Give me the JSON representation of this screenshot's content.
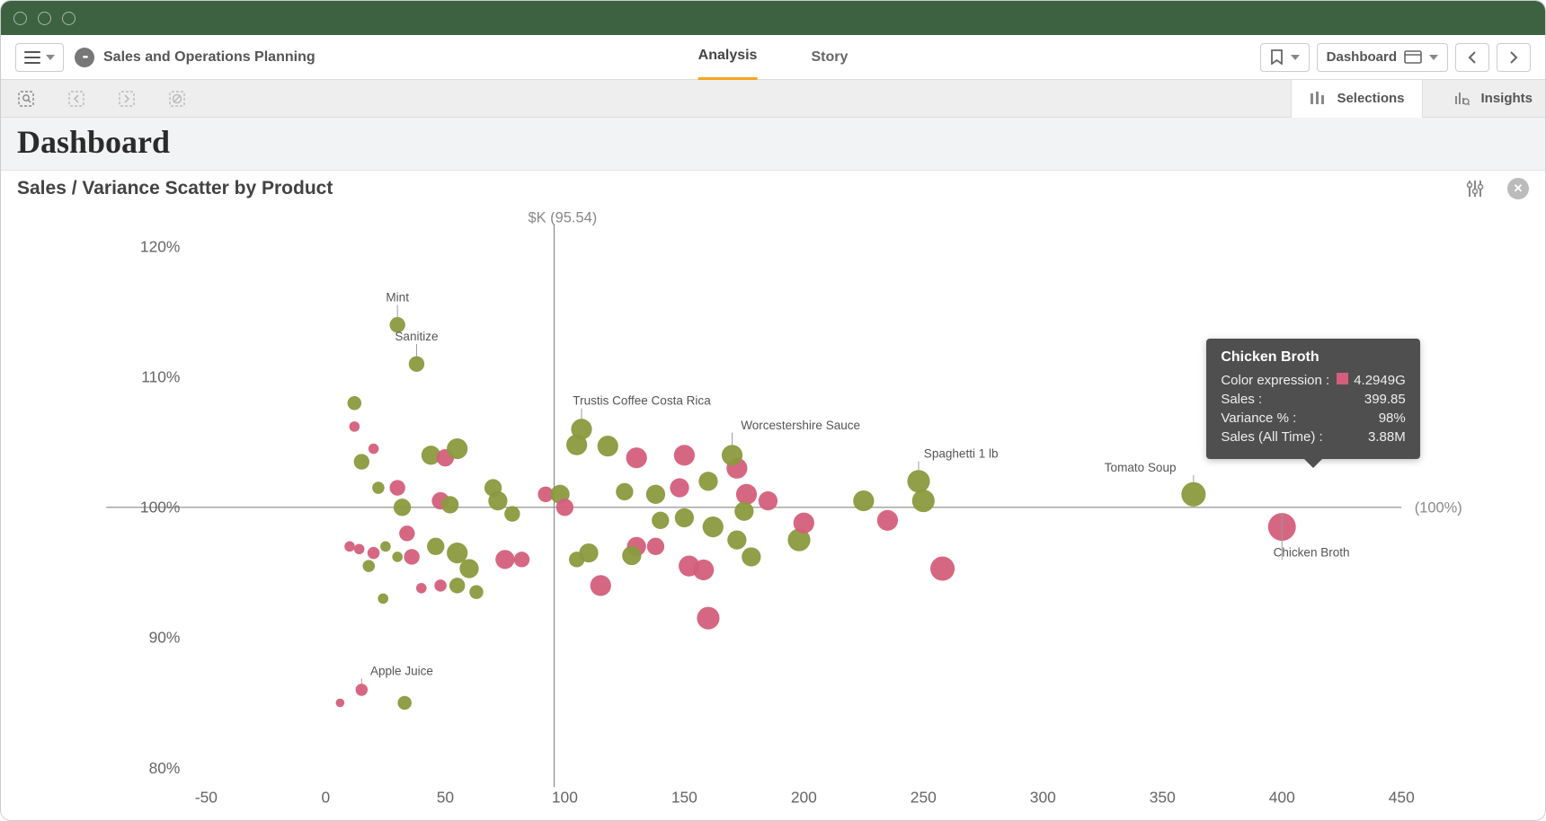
{
  "header": {
    "app_title": "Sales and Operations Planning",
    "tabs": {
      "analysis": "Analysis",
      "story": "Story",
      "active": "analysis"
    },
    "sheet_label": "Dashboard"
  },
  "selection_bar": {
    "selections_label": "Selections",
    "insights_label": "Insights"
  },
  "page": {
    "title": "Dashboard",
    "chart_title": "Sales / Variance Scatter by Product"
  },
  "tooltip": {
    "title": "Chicken Broth",
    "rows": [
      {
        "k": "Color expression :",
        "v": "4.2949G",
        "swatch": true
      },
      {
        "k": "Sales :",
        "v": "399.85"
      },
      {
        "k": "Variance % :",
        "v": "98%"
      },
      {
        "k": "Sales (All Time) :",
        "v": "3.88M"
      }
    ]
  },
  "chart_data": {
    "type": "scatter",
    "title": "Sales / Variance Scatter by Product",
    "xlabel": "",
    "ylabel": "",
    "xlim": [
      -50,
      450
    ],
    "ylim": [
      80,
      120
    ],
    "x_ticks": [
      -50,
      0,
      50,
      100,
      150,
      200,
      250,
      300,
      350,
      400,
      450
    ],
    "y_ticks": [
      80,
      90,
      100,
      110,
      120
    ],
    "x_ref_line": {
      "value": 95.54,
      "label": "$K (95.54)"
    },
    "y_ref_line": {
      "value": 100,
      "label": "(100%)"
    },
    "colors": {
      "green": "#8a9a3e",
      "pink": "#d45f7c"
    },
    "labeled_points": [
      {
        "name": "Mint",
        "x": 30,
        "y": 114,
        "color": "green",
        "size": 9
      },
      {
        "name": "Sanitize",
        "x": 38,
        "y": 111,
        "color": "green",
        "size": 9
      },
      {
        "name": "Trustis Coffee Costa Rica",
        "x": 107,
        "y": 106,
        "color": "green",
        "size": 12
      },
      {
        "name": "Worcestershire Sauce",
        "x": 170,
        "y": 104,
        "color": "green",
        "size": 12
      },
      {
        "name": "Spaghetti 1 lb",
        "x": 248,
        "y": 102,
        "color": "green",
        "size": 13
      },
      {
        "name": "Tomato Soup",
        "x": 363,
        "y": 101,
        "color": "green",
        "size": 14
      },
      {
        "name": "Chicken Broth",
        "x": 400,
        "y": 98.5,
        "color": "pink",
        "size": 16
      },
      {
        "name": "Apple Juice",
        "x": 15,
        "y": 86,
        "color": "pink",
        "size": 7
      }
    ],
    "points": [
      {
        "x": 12,
        "y": 108,
        "color": "green",
        "size": 8
      },
      {
        "x": 12,
        "y": 106.2,
        "color": "pink",
        "size": 6
      },
      {
        "x": 15,
        "y": 103.5,
        "color": "green",
        "size": 9
      },
      {
        "x": 20,
        "y": 104.5,
        "color": "pink",
        "size": 6
      },
      {
        "x": 22,
        "y": 101.5,
        "color": "green",
        "size": 7
      },
      {
        "x": 10,
        "y": 97,
        "color": "pink",
        "size": 6
      },
      {
        "x": 14,
        "y": 96.8,
        "color": "pink",
        "size": 6
      },
      {
        "x": 20,
        "y": 96.5,
        "color": "pink",
        "size": 7
      },
      {
        "x": 25,
        "y": 97,
        "color": "green",
        "size": 6
      },
      {
        "x": 18,
        "y": 95.5,
        "color": "green",
        "size": 7
      },
      {
        "x": 24,
        "y": 93,
        "color": "green",
        "size": 6
      },
      {
        "x": 6,
        "y": 85,
        "color": "pink",
        "size": 5
      },
      {
        "x": 33,
        "y": 85,
        "color": "green",
        "size": 8
      },
      {
        "x": 30,
        "y": 101.5,
        "color": "pink",
        "size": 9
      },
      {
        "x": 32,
        "y": 100,
        "color": "green",
        "size": 10
      },
      {
        "x": 34,
        "y": 98,
        "color": "pink",
        "size": 9
      },
      {
        "x": 36,
        "y": 96.2,
        "color": "pink",
        "size": 9
      },
      {
        "x": 30,
        "y": 96.2,
        "color": "green",
        "size": 6
      },
      {
        "x": 40,
        "y": 93.8,
        "color": "pink",
        "size": 6
      },
      {
        "x": 44,
        "y": 104,
        "color": "green",
        "size": 11
      },
      {
        "x": 50,
        "y": 103.8,
        "color": "pink",
        "size": 10
      },
      {
        "x": 55,
        "y": 104.5,
        "color": "green",
        "size": 12
      },
      {
        "x": 48,
        "y": 100.5,
        "color": "pink",
        "size": 10
      },
      {
        "x": 52,
        "y": 100.2,
        "color": "green",
        "size": 10
      },
      {
        "x": 46,
        "y": 97,
        "color": "green",
        "size": 10
      },
      {
        "x": 55,
        "y": 96.5,
        "color": "green",
        "size": 12
      },
      {
        "x": 60,
        "y": 95.3,
        "color": "green",
        "size": 11
      },
      {
        "x": 55,
        "y": 94,
        "color": "green",
        "size": 9
      },
      {
        "x": 48,
        "y": 94,
        "color": "pink",
        "size": 7
      },
      {
        "x": 63,
        "y": 93.5,
        "color": "green",
        "size": 8
      },
      {
        "x": 70,
        "y": 101.5,
        "color": "green",
        "size": 10
      },
      {
        "x": 72,
        "y": 100.5,
        "color": "green",
        "size": 11
      },
      {
        "x": 78,
        "y": 99.5,
        "color": "green",
        "size": 9
      },
      {
        "x": 75,
        "y": 96,
        "color": "pink",
        "size": 11
      },
      {
        "x": 82,
        "y": 96,
        "color": "pink",
        "size": 9
      },
      {
        "x": 92,
        "y": 101,
        "color": "pink",
        "size": 9
      },
      {
        "x": 98,
        "y": 101,
        "color": "green",
        "size": 11
      },
      {
        "x": 100,
        "y": 100,
        "color": "pink",
        "size": 10
      },
      {
        "x": 105,
        "y": 104.8,
        "color": "green",
        "size": 12
      },
      {
        "x": 118,
        "y": 104.7,
        "color": "green",
        "size": 12
      },
      {
        "x": 110,
        "y": 96.5,
        "color": "green",
        "size": 11
      },
      {
        "x": 115,
        "y": 94,
        "color": "pink",
        "size": 12
      },
      {
        "x": 105,
        "y": 96,
        "color": "green",
        "size": 9
      },
      {
        "x": 125,
        "y": 101.2,
        "color": "green",
        "size": 10
      },
      {
        "x": 130,
        "y": 103.8,
        "color": "pink",
        "size": 12
      },
      {
        "x": 130,
        "y": 97,
        "color": "pink",
        "size": 11
      },
      {
        "x": 128,
        "y": 96.3,
        "color": "green",
        "size": 11
      },
      {
        "x": 138,
        "y": 101,
        "color": "green",
        "size": 11
      },
      {
        "x": 138,
        "y": 97,
        "color": "pink",
        "size": 10
      },
      {
        "x": 140,
        "y": 99,
        "color": "green",
        "size": 10
      },
      {
        "x": 150,
        "y": 104,
        "color": "pink",
        "size": 12
      },
      {
        "x": 150,
        "y": 99.2,
        "color": "green",
        "size": 11
      },
      {
        "x": 148,
        "y": 101.5,
        "color": "pink",
        "size": 11
      },
      {
        "x": 152,
        "y": 95.5,
        "color": "pink",
        "size": 12
      },
      {
        "x": 158,
        "y": 95.2,
        "color": "pink",
        "size": 12
      },
      {
        "x": 160,
        "y": 102,
        "color": "green",
        "size": 11
      },
      {
        "x": 162,
        "y": 98.5,
        "color": "green",
        "size": 12
      },
      {
        "x": 160,
        "y": 91.5,
        "color": "pink",
        "size": 13
      },
      {
        "x": 172,
        "y": 103,
        "color": "pink",
        "size": 12
      },
      {
        "x": 176,
        "y": 101,
        "color": "pink",
        "size": 12
      },
      {
        "x": 175,
        "y": 99.7,
        "color": "green",
        "size": 11
      },
      {
        "x": 172,
        "y": 97.5,
        "color": "green",
        "size": 11
      },
      {
        "x": 178,
        "y": 96.2,
        "color": "green",
        "size": 11
      },
      {
        "x": 185,
        "y": 100.5,
        "color": "pink",
        "size": 11
      },
      {
        "x": 198,
        "y": 97.5,
        "color": "green",
        "size": 13
      },
      {
        "x": 200,
        "y": 98.8,
        "color": "pink",
        "size": 12
      },
      {
        "x": 225,
        "y": 100.5,
        "color": "green",
        "size": 12
      },
      {
        "x": 235,
        "y": 99,
        "color": "pink",
        "size": 12
      },
      {
        "x": 250,
        "y": 100.5,
        "color": "green",
        "size": 13
      },
      {
        "x": 258,
        "y": 95.3,
        "color": "pink",
        "size": 14
      }
    ]
  }
}
